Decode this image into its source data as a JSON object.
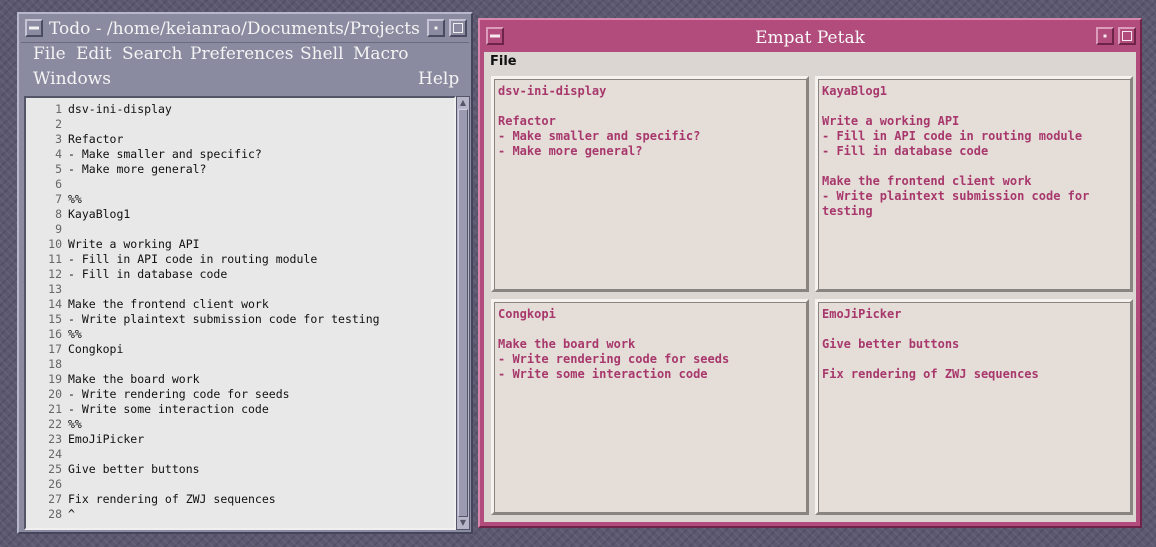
{
  "todo_window": {
    "title": "Todo - /home/keianrao/Documents/Projects",
    "menu": {
      "file": "File",
      "edit": "Edit",
      "search": "Search",
      "preferences": "Preferences",
      "shell": "Shell",
      "macro": "Macro",
      "windows": "Windows",
      "help": "Help"
    },
    "lines": [
      {
        "n": "1",
        "t": "dsv-ini-display"
      },
      {
        "n": "2",
        "t": ""
      },
      {
        "n": "3",
        "t": "Refactor"
      },
      {
        "n": "4",
        "t": "- Make smaller and specific?"
      },
      {
        "n": "5",
        "t": "- Make more general?"
      },
      {
        "n": "6",
        "t": ""
      },
      {
        "n": "7",
        "t": "%%"
      },
      {
        "n": "8",
        "t": "KayaBlog1"
      },
      {
        "n": "9",
        "t": ""
      },
      {
        "n": "10",
        "t": "Write a working API"
      },
      {
        "n": "11",
        "t": "- Fill in API code in routing module"
      },
      {
        "n": "12",
        "t": "- Fill in database code"
      },
      {
        "n": "13",
        "t": ""
      },
      {
        "n": "14",
        "t": "Make the frontend client work"
      },
      {
        "n": "15",
        "t": "- Write plaintext submission code for testing"
      },
      {
        "n": "16",
        "t": "%%"
      },
      {
        "n": "17",
        "t": "Congkopi"
      },
      {
        "n": "18",
        "t": ""
      },
      {
        "n": "19",
        "t": "Make the board work"
      },
      {
        "n": "20",
        "t": "- Write rendering code for seeds"
      },
      {
        "n": "21",
        "t": "- Write some interaction code"
      },
      {
        "n": "22",
        "t": "%%"
      },
      {
        "n": "23",
        "t": "EmoJiPicker"
      },
      {
        "n": "24",
        "t": ""
      },
      {
        "n": "25",
        "t": "Give better buttons"
      },
      {
        "n": "26",
        "t": ""
      },
      {
        "n": "27",
        "t": "Fix rendering of ZWJ sequences"
      },
      {
        "n": "28",
        "t": "^"
      }
    ]
  },
  "empat_window": {
    "title": "Empat Petak",
    "menu_file": "File",
    "panes": [
      {
        "lines": [
          "dsv-ini-display",
          "",
          "Refactor",
          "- Make smaller and specific?",
          "- Make more general?"
        ]
      },
      {
        "lines": [
          "KayaBlog1",
          "",
          "Write a working API",
          "- Fill in API code in routing module",
          "- Fill in database code",
          "",
          "Make the frontend client work",
          "- Write plaintext submission code for",
          "testing"
        ]
      },
      {
        "lines": [
          "Congkopi",
          "",
          "Make the board work",
          "- Write rendering code for seeds",
          "- Write some interaction code"
        ]
      },
      {
        "lines": [
          "EmoJiPicker",
          "",
          "Give better buttons",
          "",
          "Fix rendering of ZWJ sequences"
        ]
      }
    ]
  },
  "colors": {
    "desktop": "#5c5870",
    "todo_frame": "#8a8aa0",
    "empat_frame": "#b24c7c",
    "pane_text": "#a8386c"
  },
  "icons": [
    "window-menu-icon",
    "minimize-icon",
    "maximize-icon",
    "scroll-up-arrow-icon",
    "scroll-down-arrow-icon"
  ]
}
